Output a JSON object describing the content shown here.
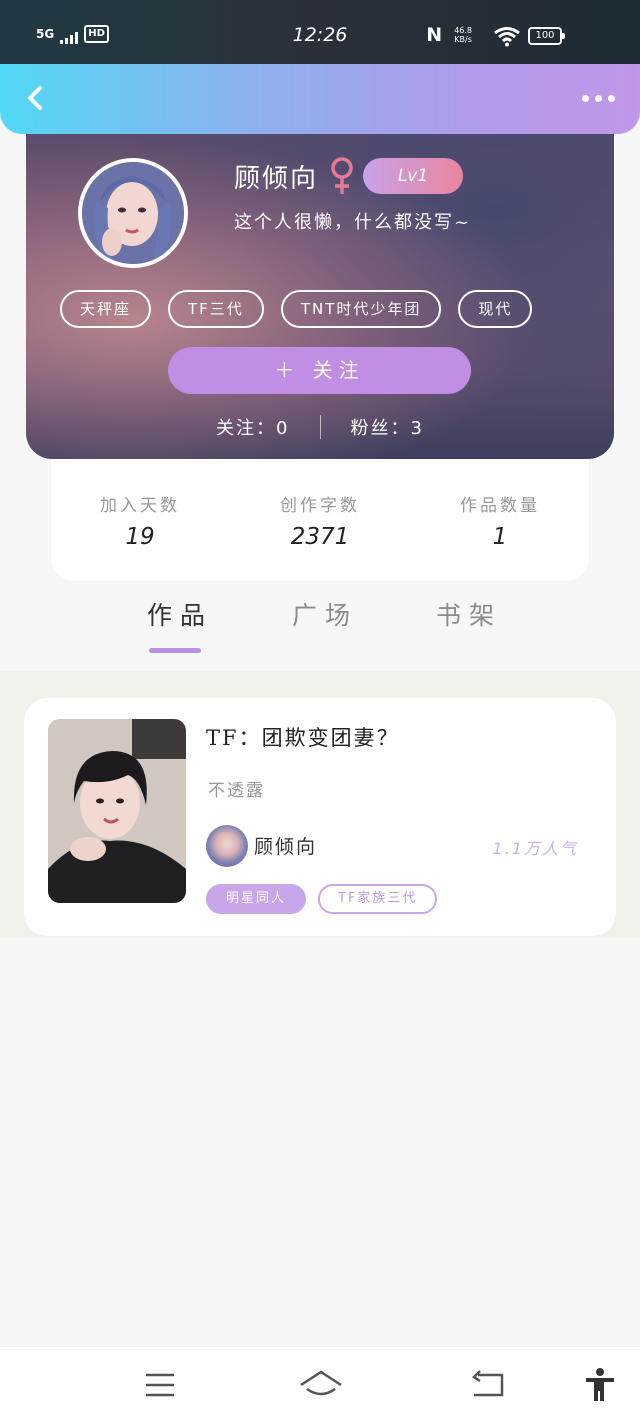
{
  "status_bar": {
    "network": "5G",
    "hd": "HD",
    "time": "12:26",
    "nfc": "N",
    "speed_value": "46.8",
    "speed_unit": "KB/s",
    "battery": "100"
  },
  "profile": {
    "name": "顾倾向",
    "level": "Lv1",
    "bio": "这个人很懒，什么都没写~",
    "tags": [
      "天秤座",
      "TF三代",
      "TNT时代少年团",
      "现代"
    ],
    "follow_label": "＋  关注",
    "following_text": "关注：0",
    "followers_text": "粉丝：3"
  },
  "stats": [
    {
      "label": "加入天数",
      "value": "19"
    },
    {
      "label": "创作字数",
      "value": "2371"
    },
    {
      "label": "作品数量",
      "value": "1"
    }
  ],
  "tabs": [
    "作品",
    "广场",
    "书架"
  ],
  "active_tab": 0,
  "work": {
    "title": "TF：团欺变团妻？",
    "desc": "不透露",
    "author": "顾倾向",
    "popularity": "1.1万人气",
    "tags": [
      "明星同人",
      "TF家族三代"
    ]
  },
  "colors": {
    "accent": "#c08ee4",
    "header_gradient_start": "#52d8f6",
    "header_gradient_end": "#c197e8",
    "female_icon": "#e87a93",
    "tab_underline": "#b893e5"
  },
  "icons": {
    "back": "back-arrow-icon",
    "more": "more-dots-icon",
    "gender": "female-icon",
    "menu": "menu-icon",
    "home": "home-icon",
    "back_nav": "back-nav-icon",
    "accessibility": "accessibility-icon"
  }
}
